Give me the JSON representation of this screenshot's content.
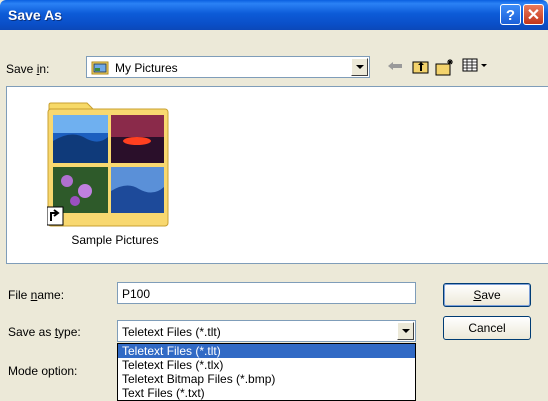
{
  "window": {
    "title": "Save As",
    "help_label": "?",
    "close_label": "✕"
  },
  "toolbar": {
    "save_in_label": "Save in:",
    "save_in_value": "My Pictures",
    "back_icon": "back-arrow-icon",
    "up_icon": "up-folder-icon",
    "new_folder_icon": "new-folder-icon",
    "views_icon": "views-menu-icon"
  },
  "files": [
    {
      "name": "Sample Pictures",
      "type": "folder-shortcut"
    }
  ],
  "form": {
    "file_name_label": "File name:",
    "file_name_value": "P100",
    "save_as_type_label": "Save as type:",
    "save_as_type_value": "Teletext Files (*.tlt)",
    "mode_option_label": "Mode option:",
    "save_button": "Save",
    "cancel_button": "Cancel",
    "type_options": [
      "Teletext Files (*.tlt)",
      "Teletext Files (*.tlx)",
      "Teletext Bitmap Files (*.bmp)",
      "Text Files (*.txt)"
    ],
    "selected_option_index": 0
  },
  "colors": {
    "titlebar": "#0a5fe0",
    "dialog_bg": "#ece9d8",
    "selection": "#316ac5",
    "field_border": "#7f9db9"
  }
}
